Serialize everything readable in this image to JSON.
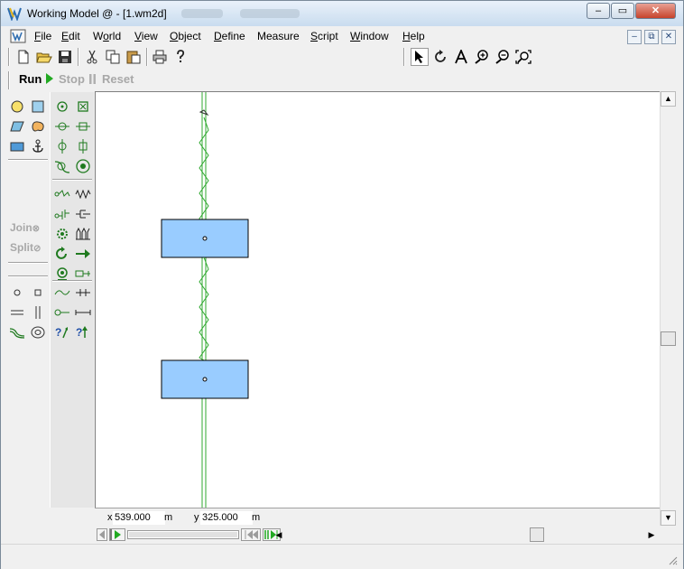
{
  "window": {
    "title": "Working Model @ - [1.wm2d]",
    "blurred_tab_1": "Плаury",
    "blurred_tab_2": "Новая Folder"
  },
  "caption_buttons": {
    "minimize": "–",
    "maximize": "▭",
    "close": "✕"
  },
  "menu": {
    "items": [
      {
        "pre": "",
        "ul": "F",
        "post": "ile"
      },
      {
        "pre": "",
        "ul": "E",
        "post": "dit"
      },
      {
        "pre": "W",
        "ul": "o",
        "post": "rld"
      },
      {
        "pre": "",
        "ul": "V",
        "post": "iew"
      },
      {
        "pre": "",
        "ul": "O",
        "post": "bject"
      },
      {
        "pre": "",
        "ul": "D",
        "post": "efine"
      },
      {
        "pre": "Measure",
        "ul": "",
        "post": ""
      },
      {
        "pre": "",
        "ul": "S",
        "post": "cript"
      },
      {
        "pre": "",
        "ul": "W",
        "post": "indow"
      },
      {
        "pre": "",
        "ul": "H",
        "post": "elp"
      }
    ],
    "mdi_minimize": "–",
    "mdi_restore": "⧉",
    "mdi_close": "✕"
  },
  "run_controls": {
    "run": "Run",
    "stop": "Stop",
    "reset": "Reset"
  },
  "palette": {
    "join": "Join",
    "split": "Split"
  },
  "coordinates": {
    "x_label": "x",
    "x_value": "539.000",
    "x_unit": "m",
    "y_label": "y",
    "y_value": "325.000",
    "y_unit": "m"
  },
  "colors": {
    "body_fill": "#99ccff",
    "spring_green": "#2fa82f",
    "run_green": "#22aa22"
  },
  "icons": {
    "file_toolbar": [
      "new-file-icon",
      "open-folder-icon",
      "save-icon",
      "cut-icon",
      "copy-icon",
      "paste-icon",
      "print-icon",
      "help-icon"
    ],
    "tool_toolbar": [
      "arrow-pointer-icon",
      "rotate-icon",
      "text-icon",
      "zoom-in-icon",
      "zoom-out-icon",
      "zoom-fit-icon"
    ]
  }
}
